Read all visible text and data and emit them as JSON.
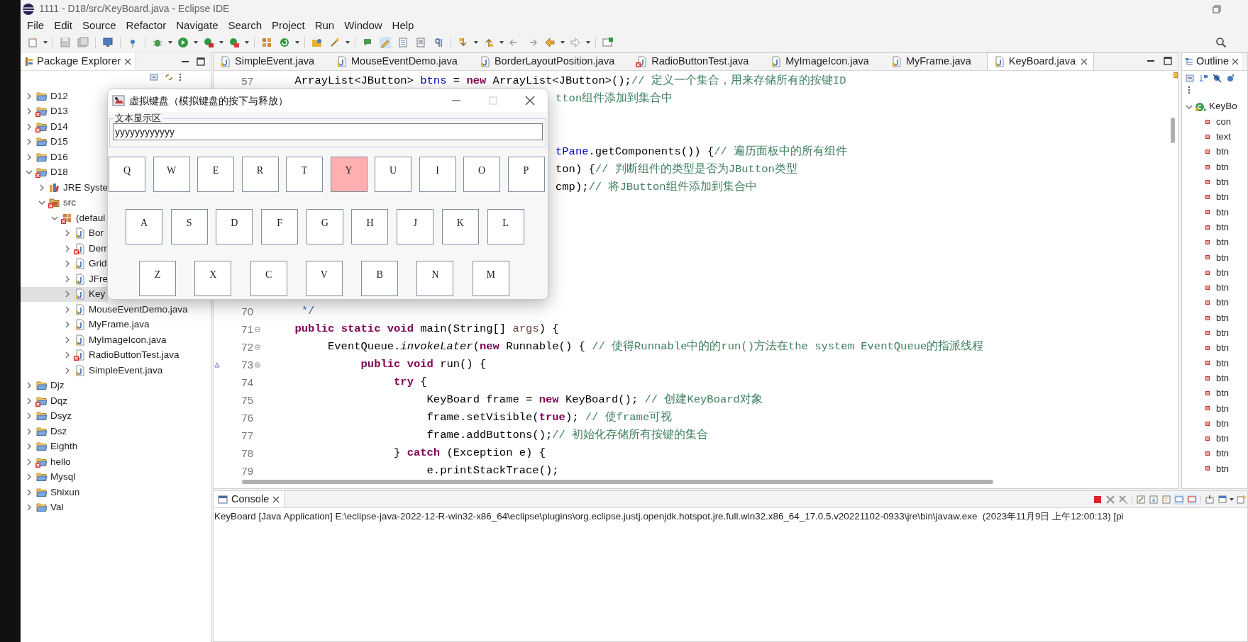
{
  "window": {
    "title": "1111 - D18/src/KeyBoard.java - Eclipse IDE"
  },
  "menu": [
    "File",
    "Edit",
    "Source",
    "Refactor",
    "Navigate",
    "Search",
    "Project",
    "Run",
    "Window",
    "Help"
  ],
  "package_explorer": {
    "title": "Package Explorer",
    "tree": [
      {
        "label": "D12",
        "kind": "project",
        "error": false,
        "expanded": false,
        "selected": false
      },
      {
        "label": "D13",
        "kind": "project",
        "error": true,
        "expanded": false,
        "selected": false
      },
      {
        "label": "D14",
        "kind": "project",
        "error": true,
        "expanded": false,
        "selected": false
      },
      {
        "label": "D15",
        "kind": "project",
        "error": false,
        "expanded": false,
        "selected": false
      },
      {
        "label": "D16",
        "kind": "project",
        "error": false,
        "expanded": false,
        "selected": false
      },
      {
        "label": "D18",
        "kind": "project",
        "error": true,
        "expanded": true,
        "selected": false,
        "children": [
          {
            "label": "JRE Syste",
            "kind": "library",
            "error": false,
            "expanded": false,
            "selected": false
          },
          {
            "label": "src",
            "kind": "source-folder",
            "error": true,
            "expanded": true,
            "selected": false,
            "children": [
              {
                "label": "(defaul",
                "kind": "package",
                "error": true,
                "expanded": true,
                "selected": false,
                "children": [
                  {
                    "label": "Bor",
                    "kind": "java-file",
                    "error": false,
                    "expanded": false,
                    "selected": false
                  },
                  {
                    "label": "Dem",
                    "kind": "java-file",
                    "error": true,
                    "expanded": false,
                    "selected": false
                  },
                  {
                    "label": "Grid",
                    "kind": "java-file",
                    "error": false,
                    "expanded": false,
                    "selected": false
                  },
                  {
                    "label": "JFre",
                    "kind": "java-file",
                    "error": false,
                    "expanded": false,
                    "selected": false
                  },
                  {
                    "label": "Key",
                    "kind": "java-file",
                    "error": false,
                    "expanded": false,
                    "selected": true
                  },
                  {
                    "label": "MouseEventDemo.java",
                    "kind": "java-file",
                    "error": false,
                    "expanded": false,
                    "selected": false
                  },
                  {
                    "label": "MyFrame.java",
                    "kind": "java-file",
                    "error": false,
                    "expanded": false,
                    "selected": false
                  },
                  {
                    "label": "MyImageIcon.java",
                    "kind": "java-file",
                    "error": false,
                    "expanded": false,
                    "selected": false
                  },
                  {
                    "label": "RadioButtonTest.java",
                    "kind": "java-file",
                    "error": true,
                    "expanded": false,
                    "selected": false
                  },
                  {
                    "label": "SimpleEvent.java",
                    "kind": "java-file",
                    "error": false,
                    "expanded": false,
                    "selected": false
                  }
                ]
              }
            ]
          }
        ]
      },
      {
        "label": "Djz",
        "kind": "project",
        "error": false,
        "expanded": false,
        "selected": false
      },
      {
        "label": "Dqz",
        "kind": "project",
        "error": true,
        "expanded": false,
        "selected": false
      },
      {
        "label": "Dsyz",
        "kind": "project",
        "error": false,
        "expanded": false,
        "selected": false
      },
      {
        "label": "Dsz",
        "kind": "project",
        "error": false,
        "expanded": false,
        "selected": false
      },
      {
        "label": "Eighth",
        "kind": "project",
        "error": false,
        "expanded": false,
        "selected": false
      },
      {
        "label": "hello",
        "kind": "project",
        "error": true,
        "expanded": false,
        "selected": false
      },
      {
        "label": "Mysql",
        "kind": "project",
        "error": false,
        "expanded": false,
        "selected": false
      },
      {
        "label": "Shixun",
        "kind": "project",
        "error": false,
        "expanded": false,
        "selected": false
      },
      {
        "label": "Val",
        "kind": "project",
        "error": false,
        "expanded": false,
        "selected": false
      }
    ]
  },
  "editor": {
    "tabs": [
      {
        "label": "SimpleEvent.java",
        "error": false,
        "selected": false
      },
      {
        "label": "MouseEventDemo.java",
        "error": false,
        "selected": false
      },
      {
        "label": "BorderLayoutPosition.java",
        "error": false,
        "selected": false
      },
      {
        "label": "RadioButtonTest.java",
        "error": true,
        "selected": false
      },
      {
        "label": "MyImageIcon.java",
        "error": false,
        "selected": false
      },
      {
        "label": "MyFrame.java",
        "error": false,
        "selected": false
      },
      {
        "label": "KeyBoard.java",
        "error": false,
        "selected": true
      }
    ],
    "lines": [
      {
        "number": "57",
        "kind": "code",
        "fold": false,
        "override": false,
        "tokens": [
          {
            "kind": "plain",
            "text": "\tArrayList<JButton> "
          },
          {
            "kind": "field",
            "text": "btns"
          },
          {
            "kind": "plain",
            "text": " = "
          },
          {
            "kind": "keyword",
            "text": "new"
          },
          {
            "kind": "plain",
            "text": " ArrayList<JButton>();"
          },
          {
            "kind": "comment",
            "text": "// 定义一个集合，用来存储所有的按键ID"
          }
        ]
      },
      {
        "kind": "covered",
        "tokens": [
          {
            "kind": "comment",
            "text": "tton组件添加到集合中"
          }
        ]
      },
      {
        "kind": "blank"
      },
      {
        "kind": "blank"
      },
      {
        "kind": "covered",
        "tokens": [
          {
            "kind": "field",
            "text": "tPane"
          },
          {
            "kind": "plain",
            "text": ".getComponents()) {"
          },
          {
            "kind": "comment",
            "text": "// 遍历面板中的所有组件"
          }
        ]
      },
      {
        "kind": "covered",
        "tokens": [
          {
            "kind": "plain",
            "text": "ton) {"
          },
          {
            "kind": "comment",
            "text": "// 判断组件的类型是否为JButton类型"
          }
        ]
      },
      {
        "kind": "covered",
        "tokens": [
          {
            "kind": "plain",
            "text": "cmp);"
          },
          {
            "kind": "comment",
            "text": "// 将JButton组件添加到集合中"
          }
        ]
      },
      {
        "kind": "blank"
      },
      {
        "kind": "blank"
      },
      {
        "kind": "blank"
      },
      {
        "kind": "blank"
      },
      {
        "kind": "blank"
      },
      {
        "kind": "blank"
      },
      {
        "number": "70",
        "kind": "code",
        "fold": false,
        "override": false,
        "tokens": [
          {
            "kind": "javadoc",
            "text": "\t */"
          }
        ]
      },
      {
        "number": "71",
        "kind": "code",
        "fold": true,
        "override": false,
        "tokens": [
          {
            "kind": "keyword",
            "text": "\tpublic static void"
          },
          {
            "kind": "plain",
            "text": " main(String[] "
          },
          {
            "kind": "param",
            "text": "args"
          },
          {
            "kind": "plain",
            "text": ") {"
          }
        ]
      },
      {
        "number": "72",
        "kind": "code",
        "fold": true,
        "override": false,
        "tokens": [
          {
            "kind": "plain",
            "text": "\t\tEventQueue."
          },
          {
            "kind": "italic",
            "text": "invokeLater"
          },
          {
            "kind": "plain",
            "text": "("
          },
          {
            "kind": "keyword",
            "text": "new"
          },
          {
            "kind": "plain",
            "text": " Runnable() { "
          },
          {
            "kind": "comment",
            "text": "// 使得Runnable中的的run()方法在the system EventQueue的指派线程"
          }
        ]
      },
      {
        "number": "73",
        "kind": "code",
        "fold": true,
        "override": true,
        "tokens": [
          {
            "kind": "keyword",
            "text": "\t\t\tpublic void"
          },
          {
            "kind": "plain",
            "text": " run() {"
          }
        ]
      },
      {
        "number": "74",
        "kind": "code",
        "fold": false,
        "override": false,
        "tokens": [
          {
            "kind": "keyword",
            "text": "\t\t\t\ttry"
          },
          {
            "kind": "plain",
            "text": " {"
          }
        ]
      },
      {
        "number": "75",
        "kind": "code",
        "fold": false,
        "override": false,
        "tokens": [
          {
            "kind": "plain",
            "text": "\t\t\t\t\tKeyBoard frame = "
          },
          {
            "kind": "keyword",
            "text": "new"
          },
          {
            "kind": "plain",
            "text": " KeyBoard(); "
          },
          {
            "kind": "comment",
            "text": "// 创建KeyBoard对象"
          }
        ]
      },
      {
        "number": "76",
        "kind": "code",
        "fold": false,
        "override": false,
        "tokens": [
          {
            "kind": "plain",
            "text": "\t\t\t\t\tframe.setVisible("
          },
          {
            "kind": "keyword",
            "text": "true"
          },
          {
            "kind": "plain",
            "text": "); "
          },
          {
            "kind": "comment",
            "text": "// 使frame可视"
          }
        ]
      },
      {
        "number": "77",
        "kind": "code",
        "fold": false,
        "override": false,
        "tokens": [
          {
            "kind": "plain",
            "text": "\t\t\t\t\tframe.addButtons();"
          },
          {
            "kind": "comment",
            "text": "// 初始化存储所有按键的集合"
          }
        ]
      },
      {
        "number": "78",
        "kind": "code",
        "fold": false,
        "override": false,
        "tokens": [
          {
            "kind": "plain",
            "text": "\t\t\t\t} "
          },
          {
            "kind": "keyword",
            "text": "catch"
          },
          {
            "kind": "plain",
            "text": " (Exception e) {"
          }
        ]
      },
      {
        "number": "79",
        "kind": "code",
        "fold": false,
        "override": false,
        "tokens": [
          {
            "kind": "plain",
            "text": "\t\t\t\t\te.printStackTrace();"
          }
        ]
      }
    ]
  },
  "outline": {
    "title": "Outline",
    "root": {
      "label": "KeyBo",
      "expanded": true,
      "children": [
        {
          "label": "con"
        },
        {
          "label": "text"
        },
        {
          "label": "btn"
        },
        {
          "label": "btn"
        },
        {
          "label": "btn"
        },
        {
          "label": "btn"
        },
        {
          "label": "btn"
        },
        {
          "label": "btn"
        },
        {
          "label": "btn"
        },
        {
          "label": "btn"
        },
        {
          "label": "btn"
        },
        {
          "label": "btn"
        },
        {
          "label": "btn"
        },
        {
          "label": "btn"
        },
        {
          "label": "btn"
        },
        {
          "label": "btn"
        },
        {
          "label": "btn"
        },
        {
          "label": "btn"
        },
        {
          "label": "btn"
        },
        {
          "label": "btn"
        },
        {
          "label": "btn"
        },
        {
          "label": "btn"
        },
        {
          "label": "btn"
        },
        {
          "label": "btn"
        }
      ]
    }
  },
  "console": {
    "title": "Console",
    "selected": true,
    "header": "KeyBoard [Java Application] E:\\eclipse-java-2022-12-R-win32-x86_64\\eclipse\\plugins\\org.eclipse.justj.openjdk.hotspot.jre.full.win32.x86_64_17.0.5.v20221102-0933\\jre\\bin\\javaw.exe  (2023年11月9日 上午12:00:13) [pi"
  },
  "dialog": {
    "title": "虚拟键盘（模拟键盘的按下与释放）",
    "group_label": "文本显示区",
    "text_value": "yyyyyyyyyyyy",
    "key_rows": [
      [
        {
          "label": "Q",
          "pressed": false
        },
        {
          "label": "W",
          "pressed": false
        },
        {
          "label": "E",
          "pressed": false
        },
        {
          "label": "R",
          "pressed": false
        },
        {
          "label": "T",
          "pressed": false
        },
        {
          "label": "Y",
          "pressed": true
        },
        {
          "label": "U",
          "pressed": false
        },
        {
          "label": "I",
          "pressed": false
        },
        {
          "label": "O",
          "pressed": false
        },
        {
          "label": "P",
          "pressed": false
        }
      ],
      [
        {
          "label": "A",
          "pressed": false
        },
        {
          "label": "S",
          "pressed": false
        },
        {
          "label": "D",
          "pressed": false
        },
        {
          "label": "F",
          "pressed": false
        },
        {
          "label": "G",
          "pressed": false
        },
        {
          "label": "H",
          "pressed": false
        },
        {
          "label": "J",
          "pressed": false
        },
        {
          "label": "K",
          "pressed": false
        },
        {
          "label": "L",
          "pressed": false
        }
      ],
      [
        {
          "label": "Z",
          "pressed": false
        },
        {
          "label": "X",
          "pressed": false
        },
        {
          "label": "C",
          "pressed": false
        },
        {
          "label": "V",
          "pressed": false
        },
        {
          "label": "B",
          "pressed": false
        },
        {
          "label": "N",
          "pressed": false
        },
        {
          "label": "M",
          "pressed": false
        }
      ]
    ]
  }
}
